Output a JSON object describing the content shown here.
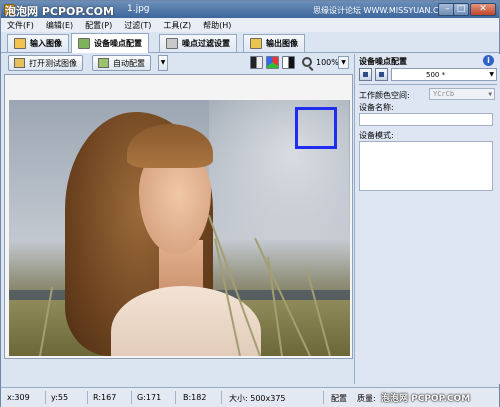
{
  "title_bar": {
    "watermark_left": "泡泡网 PCPOP.COM",
    "title_text": "1.jpg",
    "watermark_right": "思缘设计论坛  WWW.MISSYUAN.COM",
    "min_label": "–",
    "max_label": "□",
    "close_label": "✕"
  },
  "menu": [
    "文件(F)",
    "编辑(E)",
    "配置(P)",
    "过滤(T)",
    "工具(Z)",
    "帮助(H)"
  ],
  "tabs": [
    {
      "label": "输入图像",
      "icon": "image-folder-icon",
      "active": false
    },
    {
      "label": "设备噪点配置",
      "icon": "device-noise-icon",
      "active": true
    },
    {
      "label": "噪点过滤设置",
      "icon": "filter-settings-icon",
      "active": false
    },
    {
      "label": "输出图像",
      "icon": "output-image-icon",
      "active": false
    }
  ],
  "toolbar": {
    "open_test_image": "打开测试图像",
    "auto_profile": "自动配置",
    "zoom": "100%"
  },
  "panel": {
    "title": "设备噪点配置",
    "selector_value": "500 *",
    "color_space_label": "工作颜色空间:",
    "color_space_value": "YCrCb",
    "device_name_label": "设备名称:",
    "device_name_value": "",
    "device_mode_label": "设备模式:",
    "device_mode_value": ""
  },
  "status": {
    "x": "x:309",
    "y": "y:55",
    "r": "R:167",
    "g": "G:171",
    "b": "B:182",
    "size": "大小: 500x375",
    "profile": "配置",
    "quality": "质量:",
    "watermark": "泡泡网 PCPOP.COM"
  },
  "colors": {
    "selection_box": "#1f2cf2",
    "title_bar": "#3d669b",
    "panel_bg": "#dde6f2"
  }
}
